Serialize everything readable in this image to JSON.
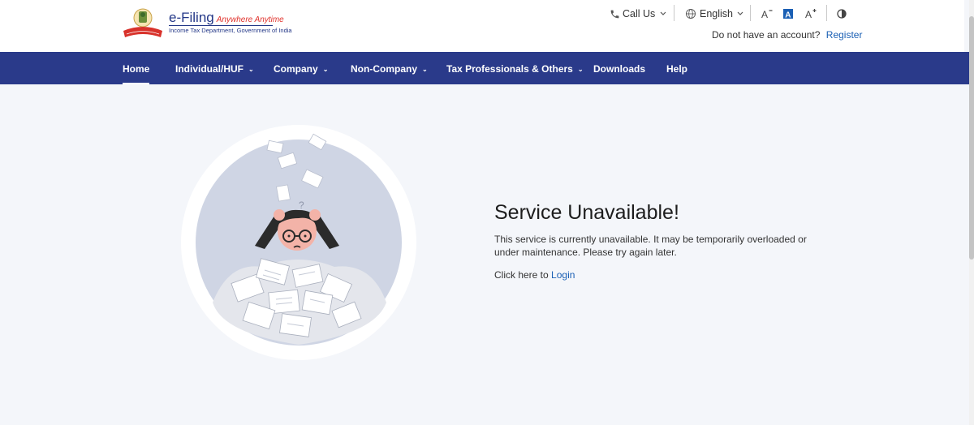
{
  "header": {
    "logo_title": "e-Filing",
    "logo_tagline": "Anywhere Anytime",
    "logo_department": "Income Tax Department, Government of India",
    "call_us": "Call Us",
    "language": "English",
    "account_prompt": "Do not have an account?",
    "register": "Register",
    "icons": [
      "phone-icon",
      "globe-icon",
      "decrease-font-icon",
      "default-font-icon",
      "increase-font-icon",
      "contrast-icon"
    ]
  },
  "nav": {
    "items": [
      {
        "label": "Home",
        "active": true
      },
      {
        "label": "Individual/HUF"
      },
      {
        "label": "Company"
      },
      {
        "label": "Non-Company"
      },
      {
        "label": "Tax Professionals & Others"
      },
      {
        "label": "Downloads"
      },
      {
        "label": "Help"
      }
    ]
  },
  "main": {
    "title": "Service Unavailable!",
    "description": "This service is currently unavailable. It may be temporarily overloaded or under maintenance. Please try again later.",
    "login_prefix": "Click here to",
    "login_link": "Login"
  },
  "colors": {
    "nav_bg": "#2a3a8a",
    "link": "#1a5fb4",
    "page_bg": "#f4f6fa"
  }
}
